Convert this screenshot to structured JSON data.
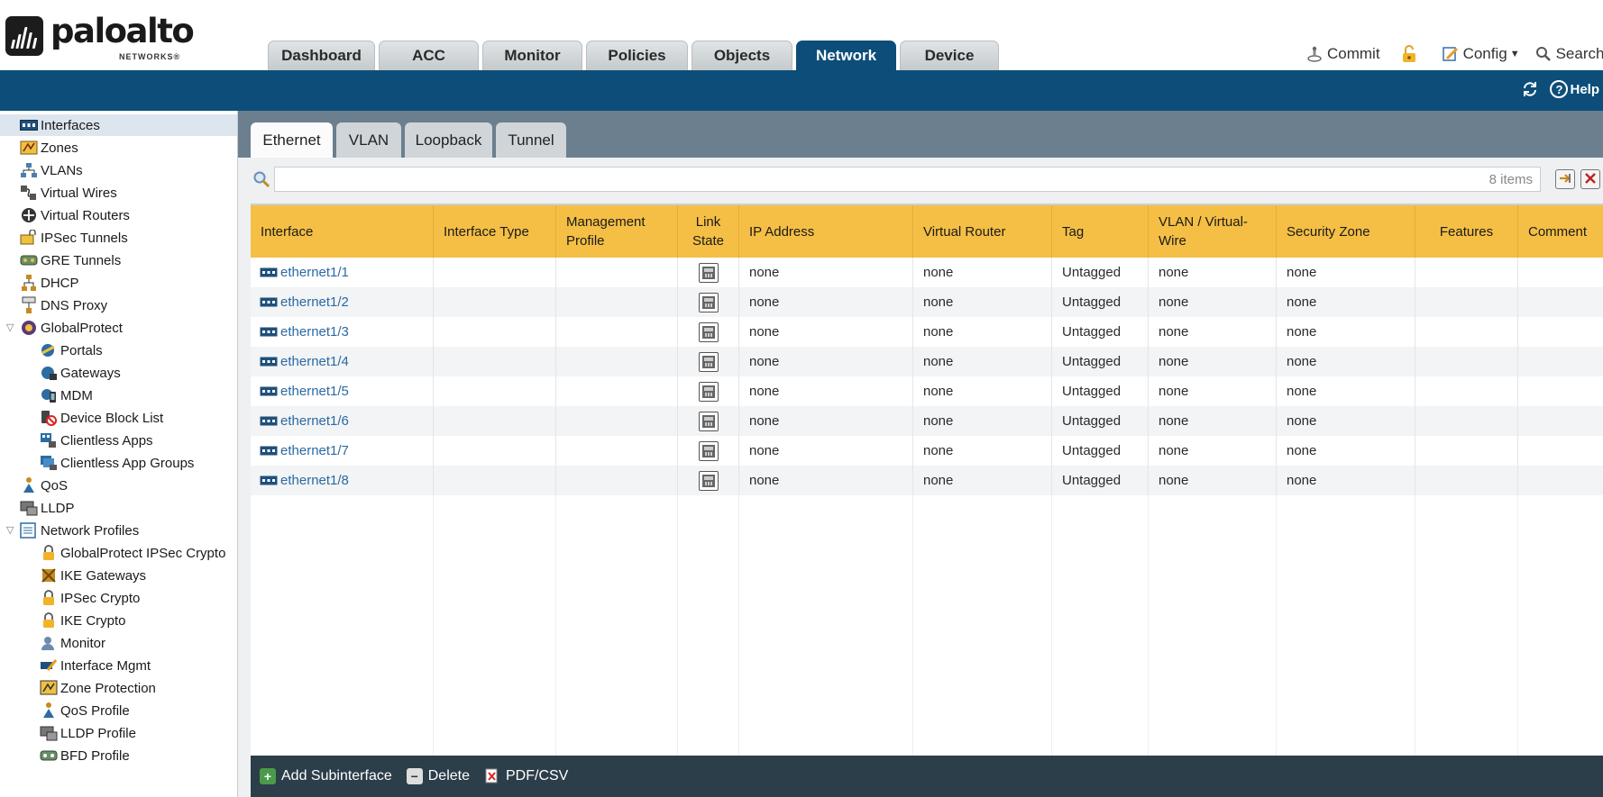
{
  "brand": {
    "name": "paloalto",
    "sub": "NETWORKS®"
  },
  "main_tabs": [
    {
      "label": "Dashboard"
    },
    {
      "label": "ACC"
    },
    {
      "label": "Monitor"
    },
    {
      "label": "Policies"
    },
    {
      "label": "Objects"
    },
    {
      "label": "Network",
      "active": true
    },
    {
      "label": "Device"
    }
  ],
  "top_actions": {
    "commit": "Commit",
    "config": "Config",
    "search": "Search"
  },
  "utility": {
    "help": "Help"
  },
  "sidebar": {
    "items": [
      {
        "label": "Interfaces",
        "icon": "interfaces-icon",
        "selected": true
      },
      {
        "label": "Zones",
        "icon": "zones-icon"
      },
      {
        "label": "VLANs",
        "icon": "vlans-icon"
      },
      {
        "label": "Virtual Wires",
        "icon": "virtual-wires-icon"
      },
      {
        "label": "Virtual Routers",
        "icon": "virtual-routers-icon"
      },
      {
        "label": "IPSec Tunnels",
        "icon": "ipsec-tunnels-icon"
      },
      {
        "label": "GRE Tunnels",
        "icon": "gre-tunnels-icon"
      },
      {
        "label": "DHCP",
        "icon": "dhcp-icon"
      },
      {
        "label": "DNS Proxy",
        "icon": "dns-proxy-icon"
      },
      {
        "label": "GlobalProtect",
        "icon": "globalprotect-icon",
        "expanded": true
      },
      {
        "label": "Portals",
        "icon": "portals-icon"
      },
      {
        "label": "Gateways",
        "icon": "gateways-icon"
      },
      {
        "label": "MDM",
        "icon": "mdm-icon"
      },
      {
        "label": "Device Block List",
        "icon": "device-block-list-icon"
      },
      {
        "label": "Clientless Apps",
        "icon": "clientless-apps-icon"
      },
      {
        "label": "Clientless App Groups",
        "icon": "clientless-app-groups-icon"
      },
      {
        "label": "QoS",
        "icon": "qos-icon"
      },
      {
        "label": "LLDP",
        "icon": "lldp-icon"
      },
      {
        "label": "Network Profiles",
        "icon": "network-profiles-icon",
        "expanded": true
      },
      {
        "label": "GlobalProtect IPSec Crypto",
        "icon": "lock-icon"
      },
      {
        "label": "IKE Gateways",
        "icon": "ike-gateways-icon"
      },
      {
        "label": "IPSec Crypto",
        "icon": "lock-icon"
      },
      {
        "label": "IKE Crypto",
        "icon": "lock-icon"
      },
      {
        "label": "Monitor",
        "icon": "monitor-icon"
      },
      {
        "label": "Interface Mgmt",
        "icon": "interface-mgmt-icon"
      },
      {
        "label": "Zone Protection",
        "icon": "zone-protection-icon"
      },
      {
        "label": "QoS Profile",
        "icon": "qos-profile-icon"
      },
      {
        "label": "LLDP Profile",
        "icon": "lldp-profile-icon"
      },
      {
        "label": "BFD Profile",
        "icon": "bfd-profile-icon"
      }
    ]
  },
  "sub_tabs": [
    {
      "label": "Ethernet",
      "active": true
    },
    {
      "label": "VLAN"
    },
    {
      "label": "Loopback"
    },
    {
      "label": "Tunnel"
    }
  ],
  "filter": {
    "count": "8 items"
  },
  "table": {
    "columns": [
      "Interface",
      "Interface Type",
      "Management Profile",
      "Link State",
      "IP Address",
      "Virtual Router",
      "Tag",
      "VLAN / Virtual-Wire",
      "Security Zone",
      "Features",
      "Comment"
    ],
    "rows": [
      {
        "interface": "ethernet1/1",
        "ip": "none",
        "router": "none",
        "tag": "Untagged",
        "vlan": "none",
        "zone": "none"
      },
      {
        "interface": "ethernet1/2",
        "ip": "none",
        "router": "none",
        "tag": "Untagged",
        "vlan": "none",
        "zone": "none"
      },
      {
        "interface": "ethernet1/3",
        "ip": "none",
        "router": "none",
        "tag": "Untagged",
        "vlan": "none",
        "zone": "none"
      },
      {
        "interface": "ethernet1/4",
        "ip": "none",
        "router": "none",
        "tag": "Untagged",
        "vlan": "none",
        "zone": "none"
      },
      {
        "interface": "ethernet1/5",
        "ip": "none",
        "router": "none",
        "tag": "Untagged",
        "vlan": "none",
        "zone": "none"
      },
      {
        "interface": "ethernet1/6",
        "ip": "none",
        "router": "none",
        "tag": "Untagged",
        "vlan": "none",
        "zone": "none"
      },
      {
        "interface": "ethernet1/7",
        "ip": "none",
        "router": "none",
        "tag": "Untagged",
        "vlan": "none",
        "zone": "none"
      },
      {
        "interface": "ethernet1/8",
        "ip": "none",
        "router": "none",
        "tag": "Untagged",
        "vlan": "none",
        "zone": "none"
      }
    ]
  },
  "footer": {
    "add": "Add Subinterface",
    "delete": "Delete",
    "export": "PDF/CSV"
  },
  "colors": {
    "nav_blue": "#0c4e79",
    "header_yellow": "#f5bf45",
    "link_blue": "#2b6aa3",
    "footer_dark": "#2c3e4a"
  }
}
